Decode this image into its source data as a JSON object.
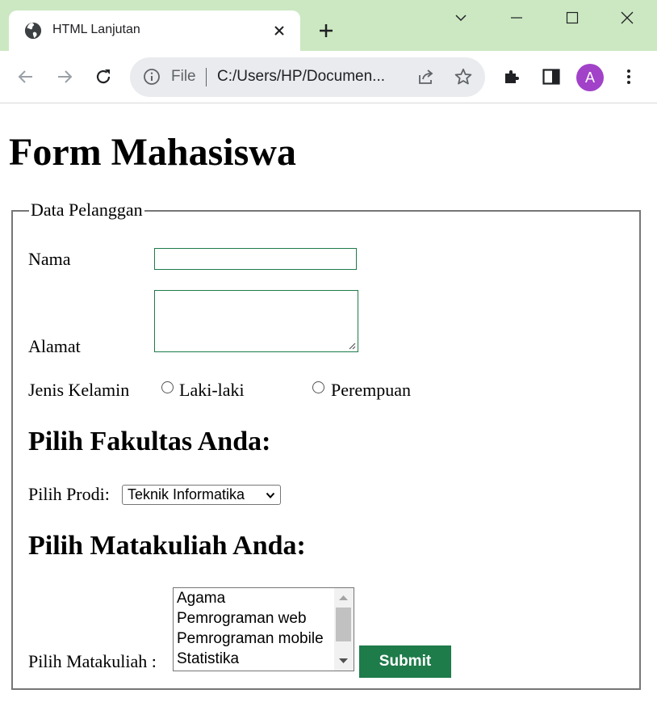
{
  "browser": {
    "tab_title": "HTML Lanjutan",
    "omnibox": {
      "scheme": "File",
      "url": "C:/Users/HP/Documen..."
    },
    "avatar_letter": "A",
    "colors": {
      "tabstrip": "#cce8c2",
      "avatar": "#a142c9"
    }
  },
  "page": {
    "title": "Form Mahasiswa",
    "fieldset": {
      "legend": "Data Pelanggan",
      "nama_label": "Nama",
      "nama_value": "",
      "alamat_label": "Alamat",
      "alamat_value": "",
      "gender_label": "Jenis Kelamin",
      "gender_options": [
        "Laki-laki",
        "Perempuan"
      ],
      "fakultas_heading": "Pilih Fakultas Anda:",
      "prodi_label": "Pilih Prodi:",
      "prodi_selected": "Teknik Informatika",
      "matakuliah_heading": "Pilih Matakuliah Anda:",
      "matakuliah_label": "Pilih Matakuliah :",
      "matakuliah_options": [
        "Agama",
        "Pemrograman web",
        "Pemrograman mobile",
        "Statistika"
      ],
      "submit_label": "Submit"
    },
    "colors": {
      "accent": "#1e7b4a"
    }
  }
}
